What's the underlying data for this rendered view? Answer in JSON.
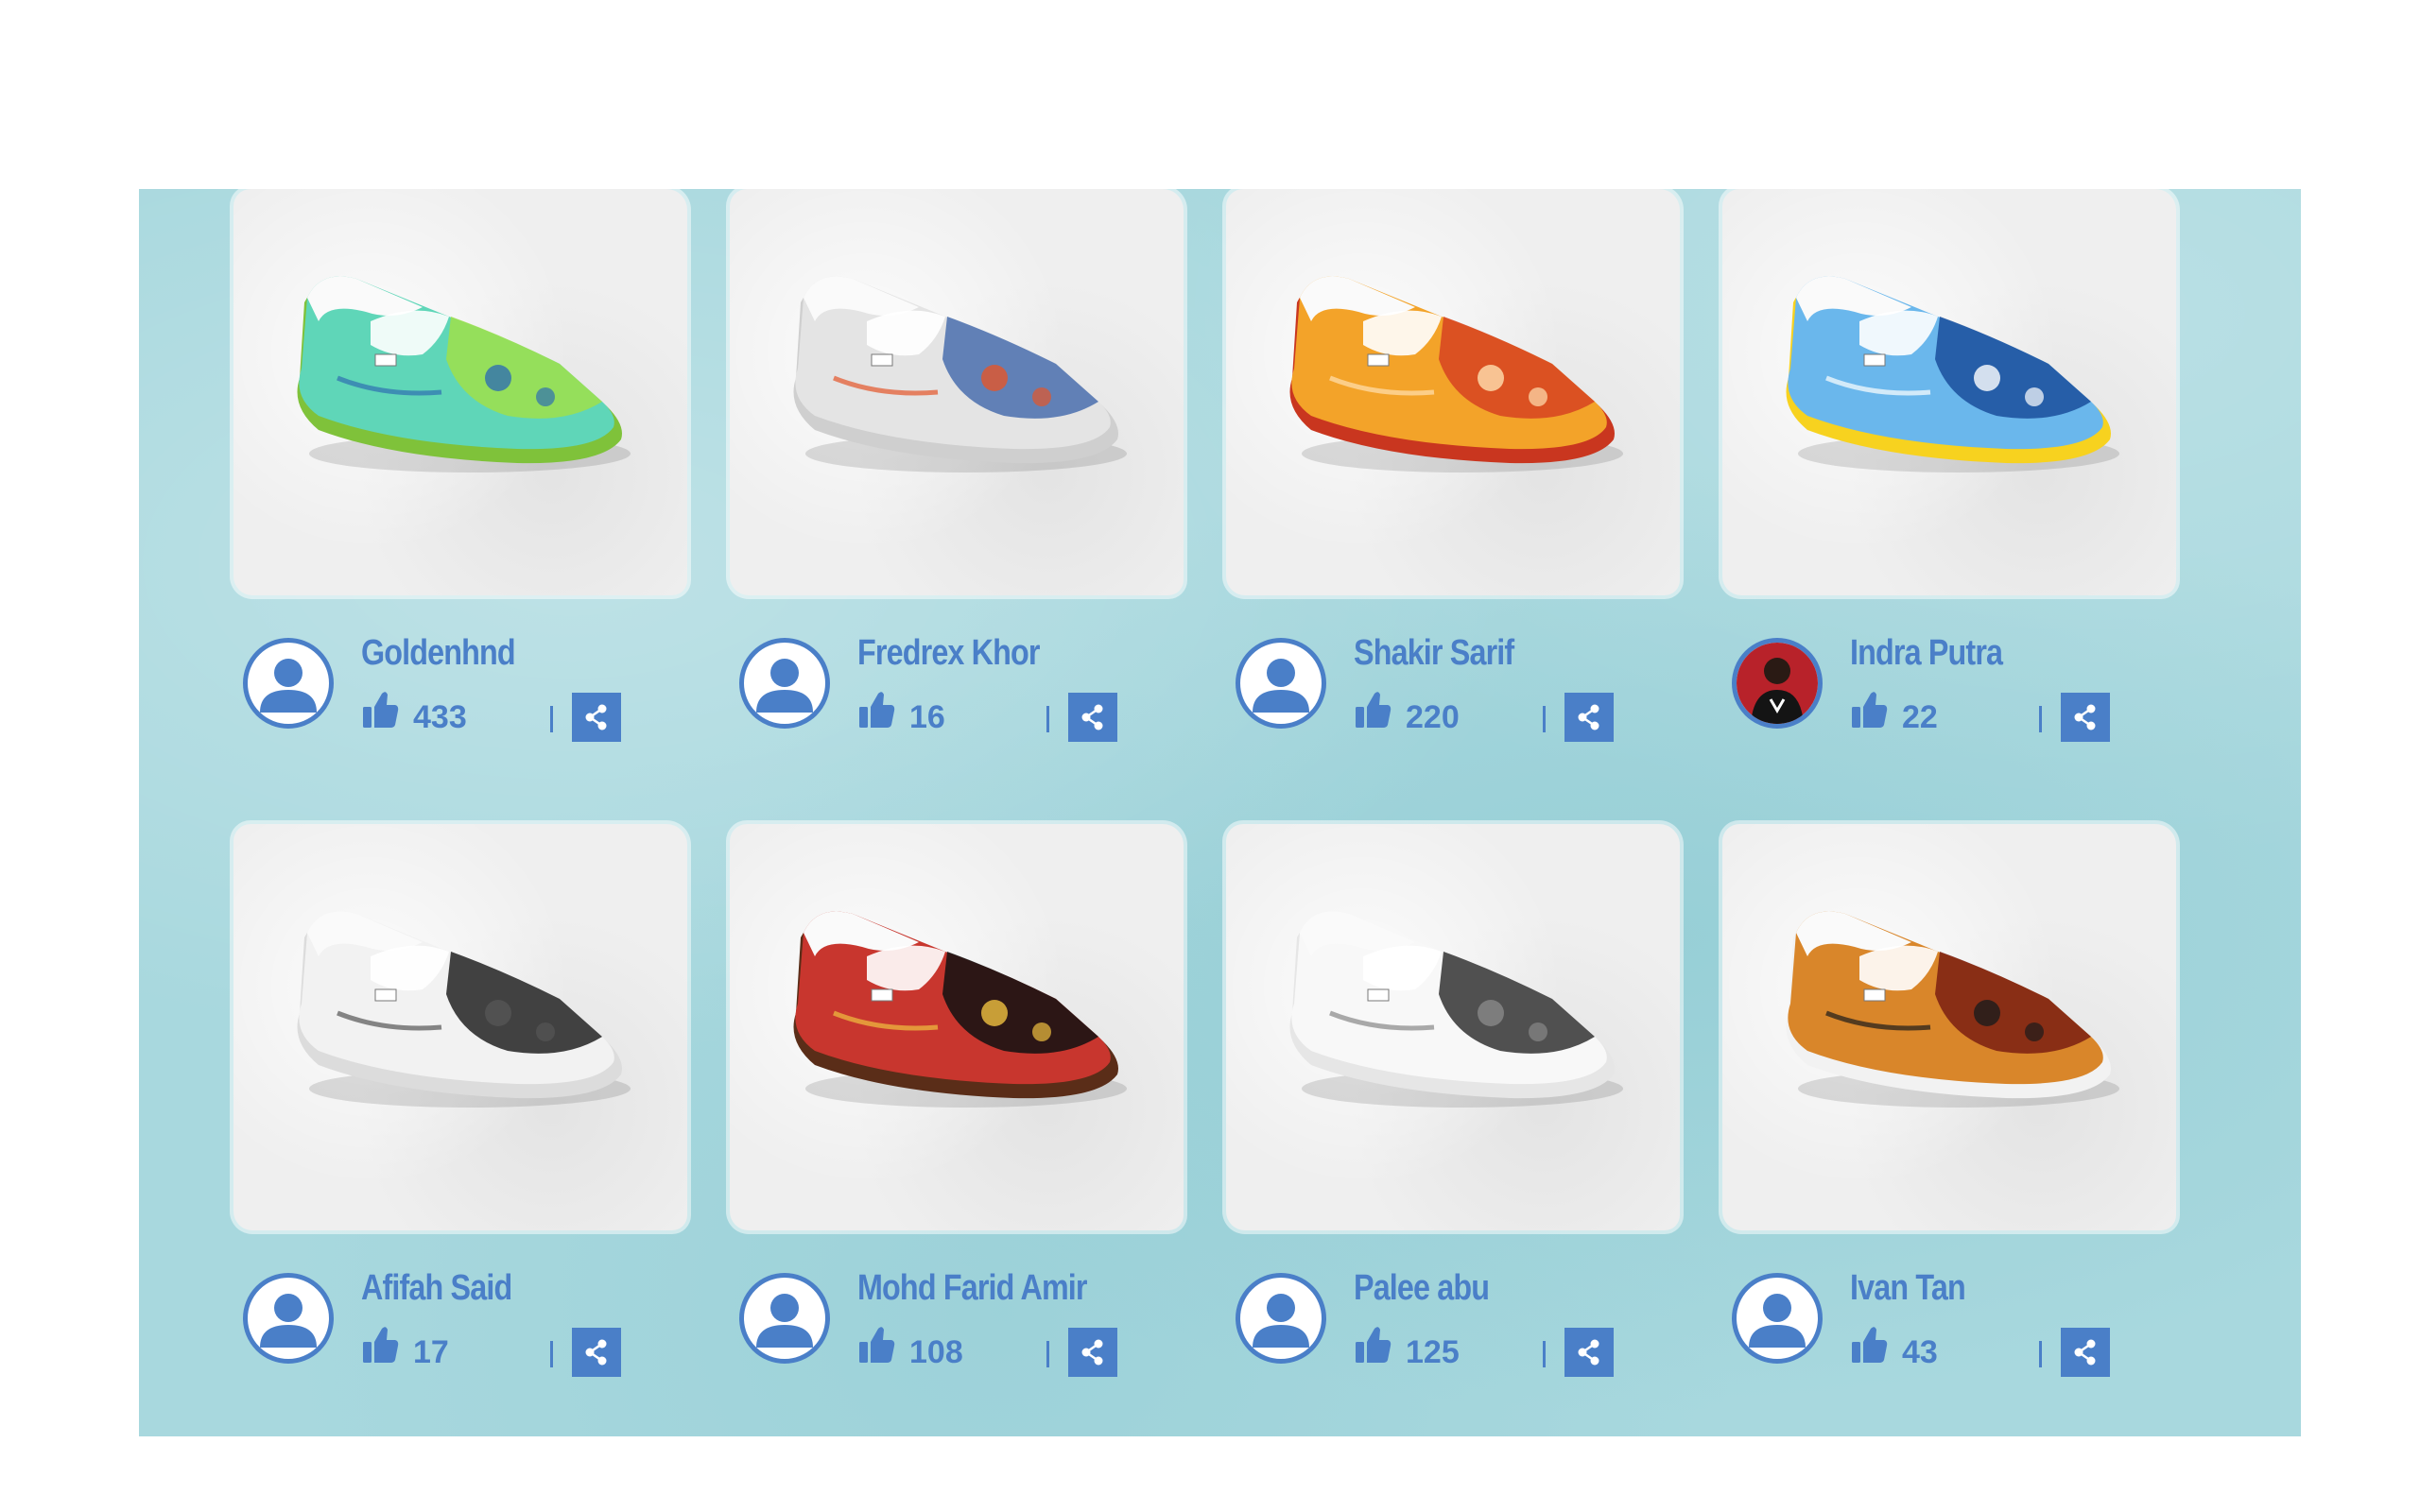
{
  "colors": {
    "accent": "#4a7fc8",
    "background": "#a8d8de",
    "card": "#efefef"
  },
  "cards": [
    {
      "author": "Goldenhnd",
      "likes": "433",
      "avatar": "default-user-icon",
      "shoe": {
        "upper": "#5fd6b8",
        "accent": "#9fe04a",
        "sole": "#7fc23a",
        "detail": "#2f6fb0"
      }
    },
    {
      "author": "Fredrex Khor",
      "likes": "16",
      "avatar": "default-user-icon",
      "shoe": {
        "upper": "#e4e4e4",
        "accent": "#4a6fae",
        "sole": "#cfcfcf",
        "detail": "#e4552a"
      }
    },
    {
      "author": "Shakir Sarif",
      "likes": "220",
      "avatar": "default-user-icon",
      "shoe": {
        "upper": "#f3a329",
        "accent": "#d64321",
        "sole": "#c9361f",
        "detail": "#ffe0b0"
      }
    },
    {
      "author": "Indra Putra",
      "likes": "22",
      "avatar": "user-photo",
      "shoe": {
        "upper": "#6ab7ec",
        "accent": "#1a4f9c",
        "sole": "#f7d21f",
        "detail": "#ffffff"
      }
    },
    {
      "author": "Afifah Said",
      "likes": "17",
      "avatar": "default-user-icon",
      "shoe": {
        "upper": "#f2f2f2",
        "accent": "#222222",
        "sole": "#dcdcdc",
        "detail": "#555555"
      }
    },
    {
      "author": "Mohd Farid Amir",
      "likes": "108",
      "avatar": "default-user-icon",
      "shoe": {
        "upper": "#c8362e",
        "accent": "#111111",
        "sole": "#5a2d18",
        "detail": "#f0c040"
      }
    },
    {
      "author": "Palee abu",
      "likes": "125",
      "avatar": "default-user-icon",
      "shoe": {
        "upper": "#f8f8f8",
        "accent": "#333333",
        "sole": "#e6e6e6",
        "detail": "#888888"
      }
    },
    {
      "author": "Ivan Tan",
      "likes": "43",
      "avatar": "default-user-icon",
      "shoe": {
        "upper": "#d9862a",
        "accent": "#7a1e12",
        "sole": "#f2f2f2",
        "detail": "#1b1b1b"
      }
    }
  ],
  "icons": {
    "like": "thumbs-up-icon",
    "share": "share-icon"
  }
}
